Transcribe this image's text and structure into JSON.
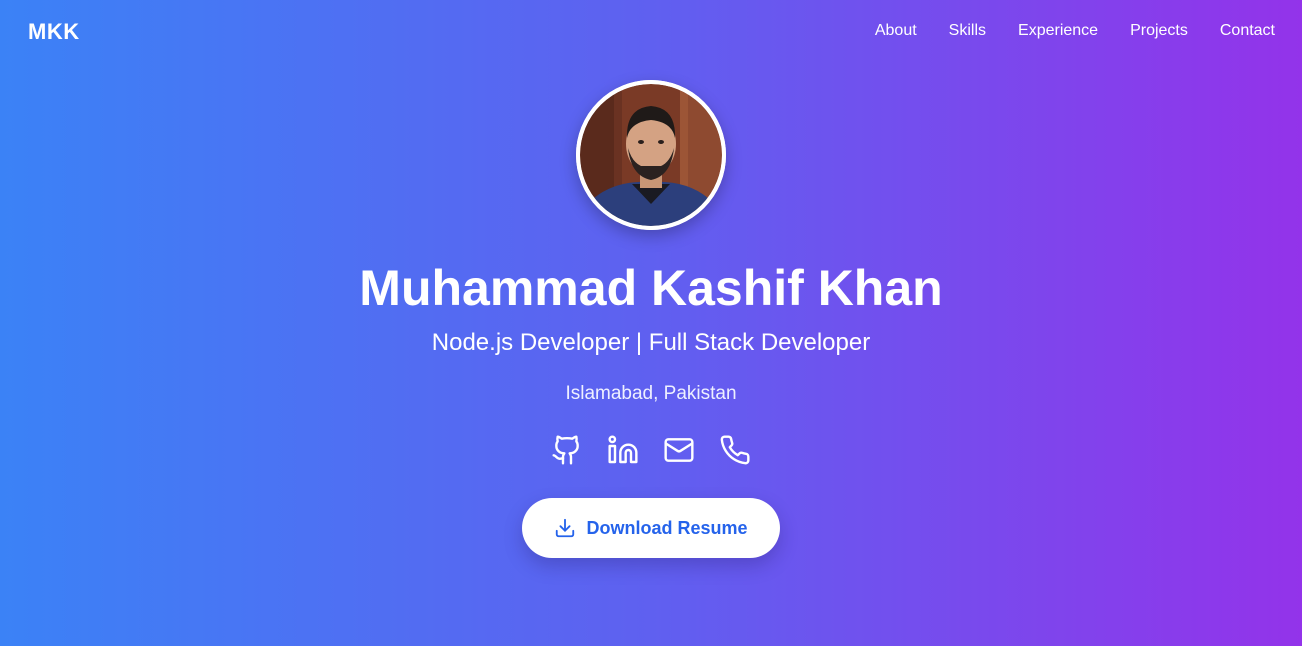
{
  "navbar": {
    "brand": "MKK",
    "links": [
      "About",
      "Skills",
      "Experience",
      "Projects",
      "Contact"
    ]
  },
  "hero": {
    "name": "Muhammad Kashif Khan",
    "role": "Node.js Developer | Full Stack Developer",
    "location": "Islamabad, Pakistan",
    "download_label": "Download Resume"
  },
  "socials": [
    {
      "icon": "github-icon"
    },
    {
      "icon": "linkedin-icon"
    },
    {
      "icon": "mail-icon"
    },
    {
      "icon": "phone-icon"
    }
  ],
  "colors": {
    "gradient_start": "#3b82f6",
    "gradient_end": "#9333ea",
    "button_text": "#2563eb",
    "button_bg": "#ffffff"
  }
}
